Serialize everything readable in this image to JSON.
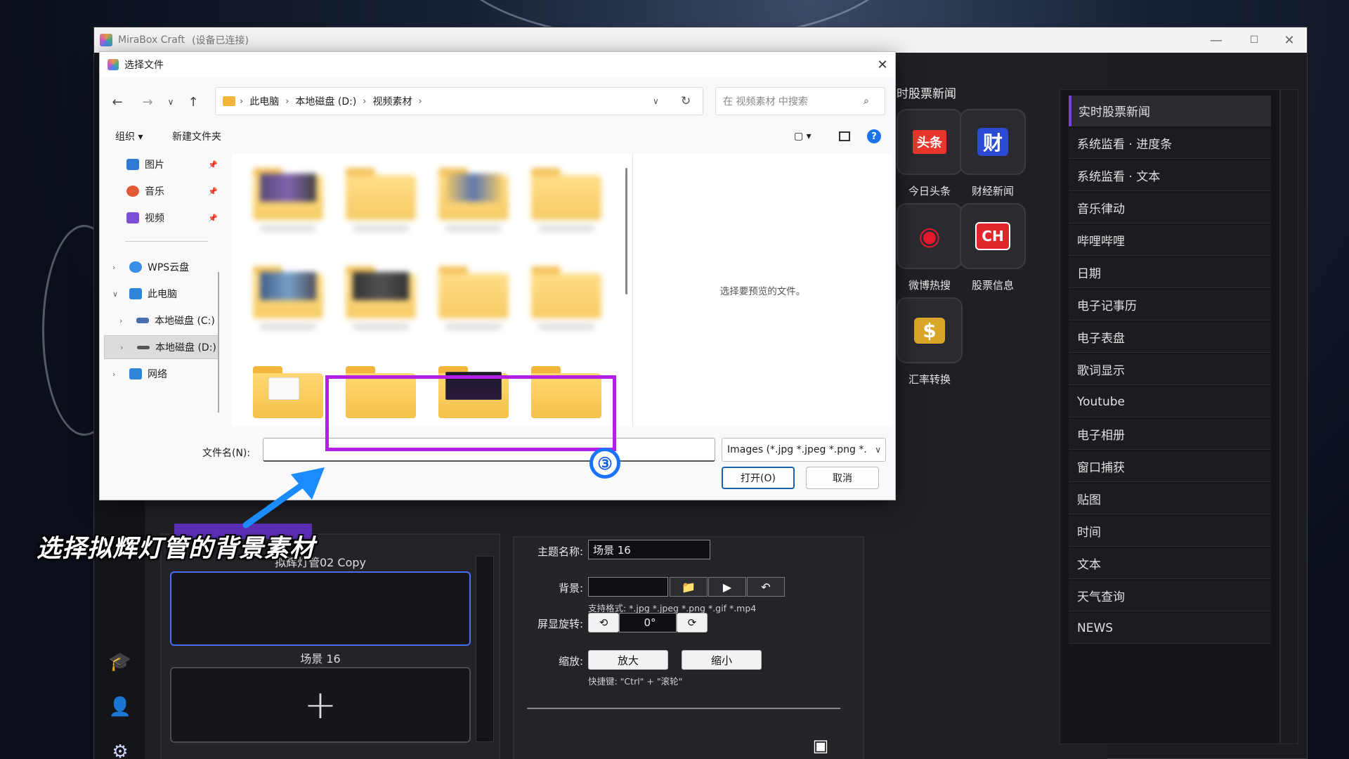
{
  "app": {
    "title": "MiraBox Craft",
    "status": "(设备已连接)",
    "window_controls": [
      "—",
      "☐",
      "✕"
    ]
  },
  "app_grid": {
    "title": "时股票新闻",
    "tiles": [
      {
        "label": "今日头条",
        "glyph": "头条",
        "icon": "toutiao-icon",
        "color": "#e8362f"
      },
      {
        "label": "财经新闻",
        "glyph": "财",
        "icon": "finance-news-icon",
        "color": "#2b4bd6"
      },
      {
        "label": "微博热搜",
        "glyph": "◉",
        "icon": "weibo-icon",
        "color": "#e6162d"
      },
      {
        "label": "股票信息",
        "glyph": "CH",
        "icon": "stock-info-icon",
        "color": "#e0252b"
      },
      {
        "label": "汇率转换",
        "glyph": "$",
        "icon": "currency-exchange-icon",
        "color": "#d9a62a"
      }
    ]
  },
  "right_list": {
    "items": [
      "实时股票新闻",
      "系统监看 · 进度条",
      "系统监看 · 文本",
      "音乐律动",
      "哔哩哔哩",
      "日期",
      "电子记事历",
      "电子表盘",
      "歌词显示",
      "Youtube",
      "电子相册",
      "窗口捕获",
      "贴图",
      "时间",
      "文本",
      "天气查询",
      "NEWS"
    ],
    "active_index": 0
  },
  "scenes": {
    "first_label": "拟辉灯管02 Copy",
    "second_label": "场景 16",
    "add_glyph": "+"
  },
  "props": {
    "theme_label": "主题名称:",
    "theme_value": "场景 16",
    "bg_label": "背景:",
    "bg_hint": "支持格式: *.jpg *.jpeg *.png *.gif *.mp4",
    "rotate_label": "屏显旋转:",
    "rotate_value": "0°",
    "zoom_label": "缩放:",
    "zoom_in": "放大",
    "zoom_out": "缩小",
    "shortcut_hint": "快捷键: \"Ctrl\" + \"滚轮\""
  },
  "dialog": {
    "title": "选择文件",
    "close": "✕",
    "breadcrumb": [
      "此电脑",
      "本地磁盘 (D:)",
      "视频素材"
    ],
    "search_placeholder": "在 视频素材 中搜索",
    "organize": "组织 ▾",
    "new_folder": "新建文件夹",
    "nav": [
      {
        "label": "图片",
        "icon": "pictures-icon",
        "color": "#2e7bd6",
        "pinned": true
      },
      {
        "label": "音乐",
        "icon": "music-icon",
        "color": "#e05a3a",
        "pinned": true
      },
      {
        "label": "视频",
        "icon": "videos-icon",
        "color": "#7b4fd6",
        "pinned": true
      },
      {
        "label": "WPS云盘",
        "icon": "wps-cloud-icon",
        "color": "#3a8ee6"
      },
      {
        "label": "此电脑",
        "icon": "this-pc-icon",
        "color": "#2f86d8"
      },
      {
        "label": "本地磁盘 (C:)",
        "icon": "drive-c-icon",
        "color": "#4a6fb0"
      },
      {
        "label": "本地磁盘 (D:)",
        "icon": "drive-d-icon",
        "color": "#555555"
      },
      {
        "label": "网络",
        "icon": "network-icon",
        "color": "#2f86d8"
      }
    ],
    "preview_text": "选择要预览的文件。",
    "filename_label": "文件名(N):",
    "filename_value": "",
    "filter": "Images (*.jpg *.jpeg *.png *.",
    "open": "打开(O)",
    "cancel": "取消"
  },
  "annotation": {
    "caption": "选择拟辉灯管的背景素材",
    "step": "③",
    "highlight_color": "#b31ee8",
    "arrow_color": "#1a8cff"
  }
}
